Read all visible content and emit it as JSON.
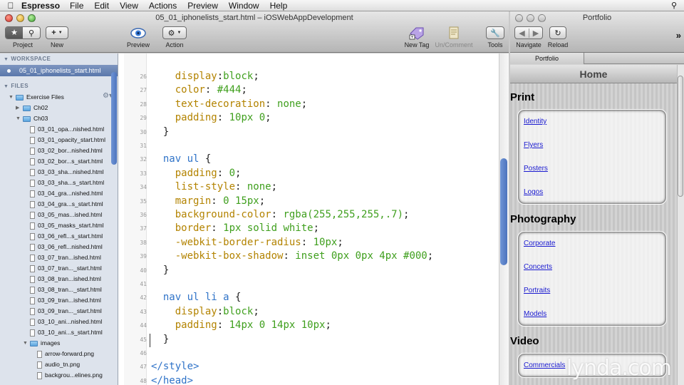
{
  "menubar": {
    "app": "Espresso",
    "items": [
      "File",
      "Edit",
      "View",
      "Actions",
      "Preview",
      "Window",
      "Help"
    ]
  },
  "editor": {
    "title": "05_01_iphonelists_start.html – iOSWebAppDevelopment",
    "toolbar": {
      "project": "Project",
      "new": "New",
      "preview": "Preview",
      "action": "Action",
      "new_tag": "New Tag",
      "un_comment": "Un/Comment",
      "tools": "Tools"
    }
  },
  "sidebar": {
    "workspace_header": "WORKSPACE",
    "open_file": "05_01_iphonelists_start.html",
    "files_header": "FILES",
    "tree": [
      {
        "label": "Exercise Files",
        "type": "folder",
        "depth": 0,
        "open": true
      },
      {
        "label": "Ch02",
        "type": "folder",
        "depth": 1,
        "open": false
      },
      {
        "label": "Ch03",
        "type": "folder",
        "depth": 1,
        "open": true
      },
      {
        "label": "03_01_opa...nished.html",
        "type": "file",
        "depth": 2
      },
      {
        "label": "03_01_opacity_start.html",
        "type": "file",
        "depth": 2
      },
      {
        "label": "03_02_bor...nished.html",
        "type": "file",
        "depth": 2
      },
      {
        "label": "03_02_bor...s_start.html",
        "type": "file",
        "depth": 2
      },
      {
        "label": "03_03_sha...nished.html",
        "type": "file",
        "depth": 2
      },
      {
        "label": "03_03_sha...s_start.html",
        "type": "file",
        "depth": 2
      },
      {
        "label": "03_04_gra...nished.html",
        "type": "file",
        "depth": 2
      },
      {
        "label": "03_04_gra...s_start.html",
        "type": "file",
        "depth": 2
      },
      {
        "label": "03_05_mas...ished.html",
        "type": "file",
        "depth": 2
      },
      {
        "label": "03_05_masks_start.html",
        "type": "file",
        "depth": 2
      },
      {
        "label": "03_06_refl...s_start.html",
        "type": "file",
        "depth": 2
      },
      {
        "label": "03_06_refl...nished.html",
        "type": "file",
        "depth": 2
      },
      {
        "label": "03_07_tran...ished.html",
        "type": "file",
        "depth": 2
      },
      {
        "label": "03_07_tran..._start.html",
        "type": "file",
        "depth": 2
      },
      {
        "label": "03_08_tran...ished.html",
        "type": "file",
        "depth": 2
      },
      {
        "label": "03_08_tran..._start.html",
        "type": "file",
        "depth": 2
      },
      {
        "label": "03_09_tran...ished.html",
        "type": "file",
        "depth": 2
      },
      {
        "label": "03_09_tran..._start.html",
        "type": "file",
        "depth": 2
      },
      {
        "label": "03_10_ani...nished.html",
        "type": "file",
        "depth": 2
      },
      {
        "label": "03_10_ani...s_start.html",
        "type": "file",
        "depth": 2
      },
      {
        "label": "images",
        "type": "folder",
        "depth": 2,
        "open": true
      },
      {
        "label": "arrow-forward.png",
        "type": "file",
        "depth": 3
      },
      {
        "label": "audio_tn.png",
        "type": "file",
        "depth": 3
      },
      {
        "label": "backgrou...elines.png",
        "type": "file",
        "depth": 3
      }
    ]
  },
  "code": {
    "lines": [
      {
        "n": "26",
        "parts": [
          [
            "    ",
            "pun"
          ],
          [
            "display",
            "prop"
          ],
          [
            ":",
            "pun"
          ],
          [
            "block",
            "val"
          ],
          [
            ";",
            "pun"
          ]
        ]
      },
      {
        "n": "27",
        "parts": [
          [
            "    ",
            "pun"
          ],
          [
            "color",
            "prop"
          ],
          [
            ": ",
            "pun"
          ],
          [
            "#444",
            "val"
          ],
          [
            ";",
            "pun"
          ]
        ]
      },
      {
        "n": "28",
        "parts": [
          [
            "    ",
            "pun"
          ],
          [
            "text-decoration",
            "prop"
          ],
          [
            ": ",
            "pun"
          ],
          [
            "none",
            "val"
          ],
          [
            ";",
            "pun"
          ]
        ]
      },
      {
        "n": "29",
        "parts": [
          [
            "    ",
            "pun"
          ],
          [
            "padding",
            "prop"
          ],
          [
            ": ",
            "pun"
          ],
          [
            "10px 0",
            "val"
          ],
          [
            ";",
            "pun"
          ]
        ]
      },
      {
        "n": "30",
        "parts": [
          [
            "  }",
            "pun"
          ]
        ]
      },
      {
        "n": "31",
        "parts": []
      },
      {
        "n": "32",
        "parts": [
          [
            "  ",
            "pun"
          ],
          [
            "nav ul",
            "sel"
          ],
          [
            " {",
            "pun"
          ]
        ]
      },
      {
        "n": "33",
        "parts": [
          [
            "    ",
            "pun"
          ],
          [
            "padding",
            "prop"
          ],
          [
            ": ",
            "pun"
          ],
          [
            "0",
            "val"
          ],
          [
            ";",
            "pun"
          ]
        ]
      },
      {
        "n": "34",
        "parts": [
          [
            "    ",
            "pun"
          ],
          [
            "list-style",
            "prop"
          ],
          [
            ": ",
            "pun"
          ],
          [
            "none",
            "val"
          ],
          [
            ";",
            "pun"
          ]
        ]
      },
      {
        "n": "35",
        "parts": [
          [
            "    ",
            "pun"
          ],
          [
            "margin",
            "prop"
          ],
          [
            ": ",
            "pun"
          ],
          [
            "0 15px",
            "val"
          ],
          [
            ";",
            "pun"
          ]
        ]
      },
      {
        "n": "36",
        "parts": [
          [
            "    ",
            "pun"
          ],
          [
            "background-color",
            "prop"
          ],
          [
            ": ",
            "pun"
          ],
          [
            "rgba(255,255,255,.7)",
            "val"
          ],
          [
            ";",
            "pun"
          ]
        ]
      },
      {
        "n": "37",
        "parts": [
          [
            "    ",
            "pun"
          ],
          [
            "border",
            "prop"
          ],
          [
            ": ",
            "pun"
          ],
          [
            "1px solid white",
            "val"
          ],
          [
            ";",
            "pun"
          ]
        ]
      },
      {
        "n": "38",
        "parts": [
          [
            "    ",
            "pun"
          ],
          [
            "-webkit-border-radius",
            "prop"
          ],
          [
            ": ",
            "pun"
          ],
          [
            "10px",
            "val"
          ],
          [
            ";",
            "pun"
          ]
        ]
      },
      {
        "n": "39",
        "parts": [
          [
            "    ",
            "pun"
          ],
          [
            "-webkit-box-shadow",
            "prop"
          ],
          [
            ": ",
            "pun"
          ],
          [
            "inset 0px 0px 4px #000",
            "val"
          ],
          [
            ";",
            "pun"
          ]
        ]
      },
      {
        "n": "40",
        "parts": [
          [
            "  }",
            "pun"
          ]
        ]
      },
      {
        "n": "41",
        "parts": []
      },
      {
        "n": "42",
        "parts": [
          [
            "  ",
            "pun"
          ],
          [
            "nav ul li a",
            "sel"
          ],
          [
            " {",
            "pun"
          ]
        ]
      },
      {
        "n": "43",
        "parts": [
          [
            "    ",
            "pun"
          ],
          [
            "display",
            "prop"
          ],
          [
            ":",
            "pun"
          ],
          [
            "block",
            "val"
          ],
          [
            ";",
            "pun"
          ]
        ]
      },
      {
        "n": "44",
        "parts": [
          [
            "    ",
            "pun"
          ],
          [
            "padding",
            "prop"
          ],
          [
            ": ",
            "pun"
          ],
          [
            "14px 0 14px 10px",
            "val"
          ],
          [
            ";",
            "pun"
          ]
        ]
      },
      {
        "n": "45",
        "parts": [
          [
            "  }",
            "pun"
          ]
        ]
      },
      {
        "n": "46",
        "parts": []
      },
      {
        "n": "47",
        "parts": [
          [
            "</style>",
            "tag"
          ]
        ]
      },
      {
        "n": "48",
        "parts": [
          [
            "</head>",
            "tag"
          ]
        ]
      }
    ]
  },
  "portfolio": {
    "title": "Portfolio",
    "toolbar": {
      "navigate": "Navigate",
      "reload": "Reload"
    },
    "tab": "Portfolio",
    "home": "Home",
    "sections": [
      {
        "title": "Print",
        "items": [
          "Identity",
          "Flyers",
          "Posters",
          "Logos"
        ]
      },
      {
        "title": "Photography",
        "items": [
          "Corporate",
          "Concerts",
          "Portraits",
          "Models"
        ]
      },
      {
        "title": "Video",
        "items": [
          "Commercials"
        ]
      }
    ]
  },
  "watermark": "lynda.com"
}
